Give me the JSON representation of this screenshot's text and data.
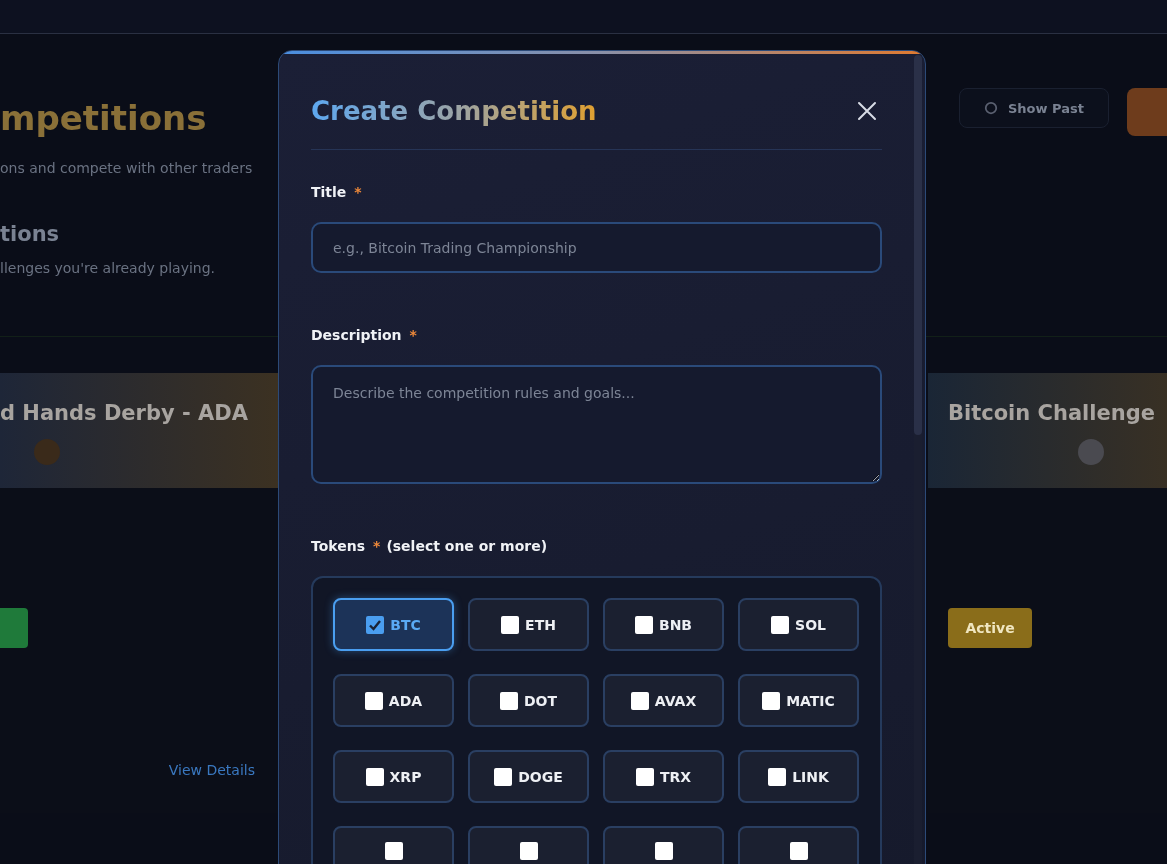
{
  "page": {
    "heading": "mpetitions",
    "subtitle": "ons and compete with other traders",
    "section_heading": "tions",
    "section_subtitle": "llenges you're already playing.",
    "show_past_button": "Show Past",
    "cards": [
      {
        "title": "d Hands Derby - ADA",
        "color": "#1f7a3a",
        "link": "View Details"
      },
      {
        "title": "Bitcoin Challenge",
        "badge": "Active",
        "color": "#8a6d1a"
      }
    ]
  },
  "modal": {
    "title": "Create Competition",
    "fields": [
      {
        "label": "Title",
        "required_mark": "*",
        "kind": "input",
        "placeholder": "e.g., Bitcoin Trading Championship"
      },
      {
        "label": "Description",
        "required_mark": "*",
        "kind": "textarea",
        "placeholder": "Describe the competition rules and goals..."
      }
    ],
    "tokens": {
      "label": "Tokens",
      "required_mark": "*",
      "hint": "(select one or more)",
      "options": [
        {
          "kind": "token",
          "label": "BTC",
          "checked": true
        },
        {
          "kind": "token",
          "label": "ETH",
          "checked": false
        },
        {
          "kind": "token",
          "label": "BNB",
          "checked": false
        },
        {
          "kind": "token",
          "label": "SOL",
          "checked": false
        },
        {
          "kind": "token",
          "label": "ADA",
          "checked": false
        },
        {
          "kind": "token",
          "label": "DOT",
          "checked": false
        },
        {
          "kind": "token",
          "label": "AVAX",
          "checked": false
        },
        {
          "kind": "token",
          "label": "MATIC",
          "checked": false
        },
        {
          "kind": "token",
          "label": "XRP",
          "checked": false
        },
        {
          "kind": "token",
          "label": "DOGE",
          "checked": false
        },
        {
          "kind": "token",
          "label": "TRX",
          "checked": false
        },
        {
          "kind": "token",
          "label": "LINK",
          "checked": false
        },
        {
          "kind": "cut",
          "checked": false
        },
        {
          "kind": "cut",
          "checked": false
        },
        {
          "kind": "cut",
          "checked": false
        },
        {
          "kind": "cut",
          "checked": false
        }
      ]
    }
  }
}
